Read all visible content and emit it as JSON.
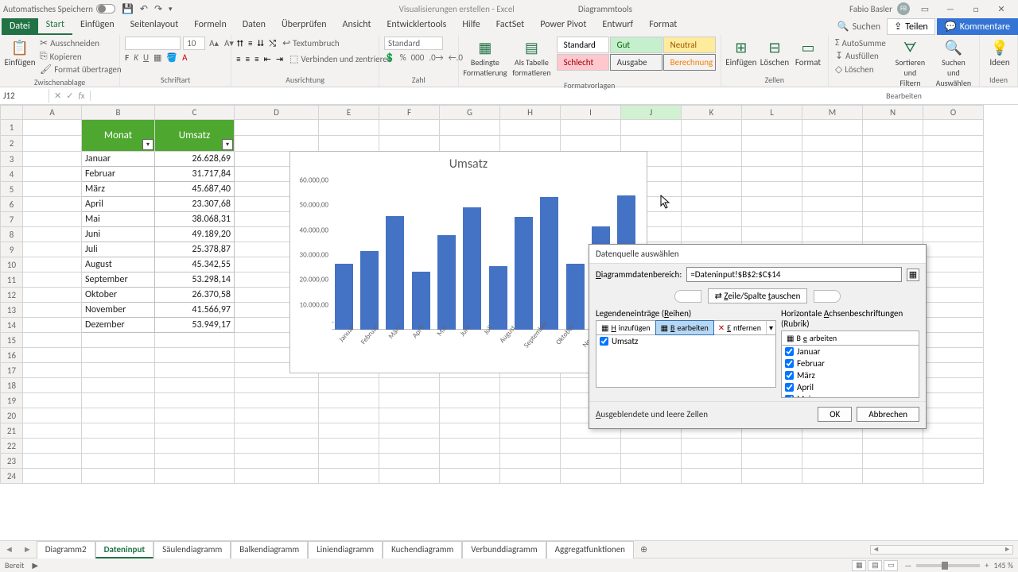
{
  "titlebar": {
    "autosave": "Automatisches Speichern",
    "doc_title": "Visualisierungen erstellen - Excel",
    "tool_context": "Diagrammtools",
    "user": "Fabio Basler",
    "user_initials": "FB"
  },
  "tabs": {
    "file": "Datei",
    "items": [
      "Start",
      "Einfügen",
      "Seitenlayout",
      "Formeln",
      "Daten",
      "Überprüfen",
      "Ansicht",
      "Entwicklertools",
      "Hilfe",
      "FactSet",
      "Power Pivot",
      "Entwurf",
      "Format"
    ],
    "active": "Start",
    "search_hint": "Suchen",
    "share": "Teilen",
    "comments": "Kommentare"
  },
  "ribbon": {
    "clipboard": {
      "paste": "Einfügen",
      "cut": "Ausschneiden",
      "copy": "Kopieren",
      "fmt": "Format übertragen",
      "label": "Zwischenablage"
    },
    "font": {
      "size": "10",
      "label": "Schriftart"
    },
    "align": {
      "wrap": "Textumbruch",
      "merge": "Verbinden und zentrieren",
      "label": "Ausrichtung"
    },
    "number": {
      "fmt": "Standard",
      "label": "Zahl"
    },
    "styles": {
      "cond": "Bedingte Formatierung",
      "table": "Als Tabelle formatieren",
      "cells": {
        "standard": "Standard",
        "gut": "Gut",
        "neutral": "Neutral",
        "schlecht": "Schlecht",
        "ausgabe": "Ausgabe",
        "berechnung": "Berechnung"
      },
      "label": "Formatvorlagen"
    },
    "cells": {
      "insert": "Einfügen",
      "delete": "Löschen",
      "format": "Format",
      "label": "Zellen"
    },
    "editing": {
      "sum": "AutoSumme",
      "fill": "Ausfüllen",
      "clear": "Löschen",
      "sort": "Sortieren und Filtern",
      "find": "Suchen und Auswählen",
      "label": "Bearbeiten"
    },
    "ideas": {
      "btn": "Ideen",
      "label": "Ideen"
    }
  },
  "fbar": {
    "cell_ref": "J12"
  },
  "columns": [
    "A",
    "B",
    "C",
    "D",
    "E",
    "F",
    "G",
    "H",
    "I",
    "J",
    "K",
    "L",
    "M",
    "N",
    "O"
  ],
  "table": {
    "header_month": "Monat",
    "header_value": "Umsatz",
    "rows": [
      {
        "m": "Januar",
        "v": "26.628,69"
      },
      {
        "m": "Februar",
        "v": "31.717,84"
      },
      {
        "m": "März",
        "v": "45.687,40"
      },
      {
        "m": "April",
        "v": "23.307,68"
      },
      {
        "m": "Mai",
        "v": "38.068,31"
      },
      {
        "m": "Juni",
        "v": "49.189,20"
      },
      {
        "m": "Juli",
        "v": "25.378,87"
      },
      {
        "m": "August",
        "v": "45.342,55"
      },
      {
        "m": "September",
        "v": "53.298,14"
      },
      {
        "m": "Oktober",
        "v": "26.370,58"
      },
      {
        "m": "November",
        "v": "41.566,97"
      },
      {
        "m": "Dezember",
        "v": "53.949,17"
      }
    ]
  },
  "chart_data": {
    "type": "bar",
    "title": "Umsatz",
    "categories": [
      "Januar",
      "Februar",
      "März",
      "April",
      "Mai",
      "Juni",
      "Juli",
      "August",
      "September",
      "Oktober",
      "November",
      "Dezember"
    ],
    "values": [
      26628.69,
      31717.84,
      45687.4,
      23307.68,
      38068.31,
      49189.2,
      25378.87,
      45342.55,
      53298.14,
      26370.58,
      41566.97,
      53949.17
    ],
    "ylabels": [
      "60.000,00",
      "50.000,00",
      "40.000,00",
      "30.000,00",
      "20.000,00",
      "10.000,00"
    ],
    "ymax": 60000,
    "ydash": "-"
  },
  "dialog": {
    "title": "Datenquelle auswählen",
    "range_label": "Diagrammdatenbereich:",
    "range_value": "=Dateninput!$B$2:$C$14",
    "swap": "Zeile/Spalte tauschen",
    "legend_title": "Legendeneinträge (Reihen)",
    "axis_title": "Horizontale Achsenbeschriftungen (Rubrik)",
    "add": "Hinzufügen",
    "edit": "Bearbeiten",
    "remove": "Entfernen",
    "edit2": "Bearbeiten",
    "series": [
      "Umsatz"
    ],
    "categories": [
      "Januar",
      "Februar",
      "März",
      "April",
      "Mai"
    ],
    "hidden_cells": "Ausgeblendete und leere Zellen",
    "ok": "OK",
    "cancel": "Abbrechen"
  },
  "sheets": {
    "tabs": [
      "Diagramm2",
      "Dateninput",
      "Säulendiagramm",
      "Balkendiagramm",
      "Liniendiagramm",
      "Kuchendiagramm",
      "Verbunddiagramm",
      "Aggregatfunktionen"
    ],
    "active": "Dateninput"
  },
  "status": {
    "ready": "Bereit",
    "zoom": "145 %"
  }
}
